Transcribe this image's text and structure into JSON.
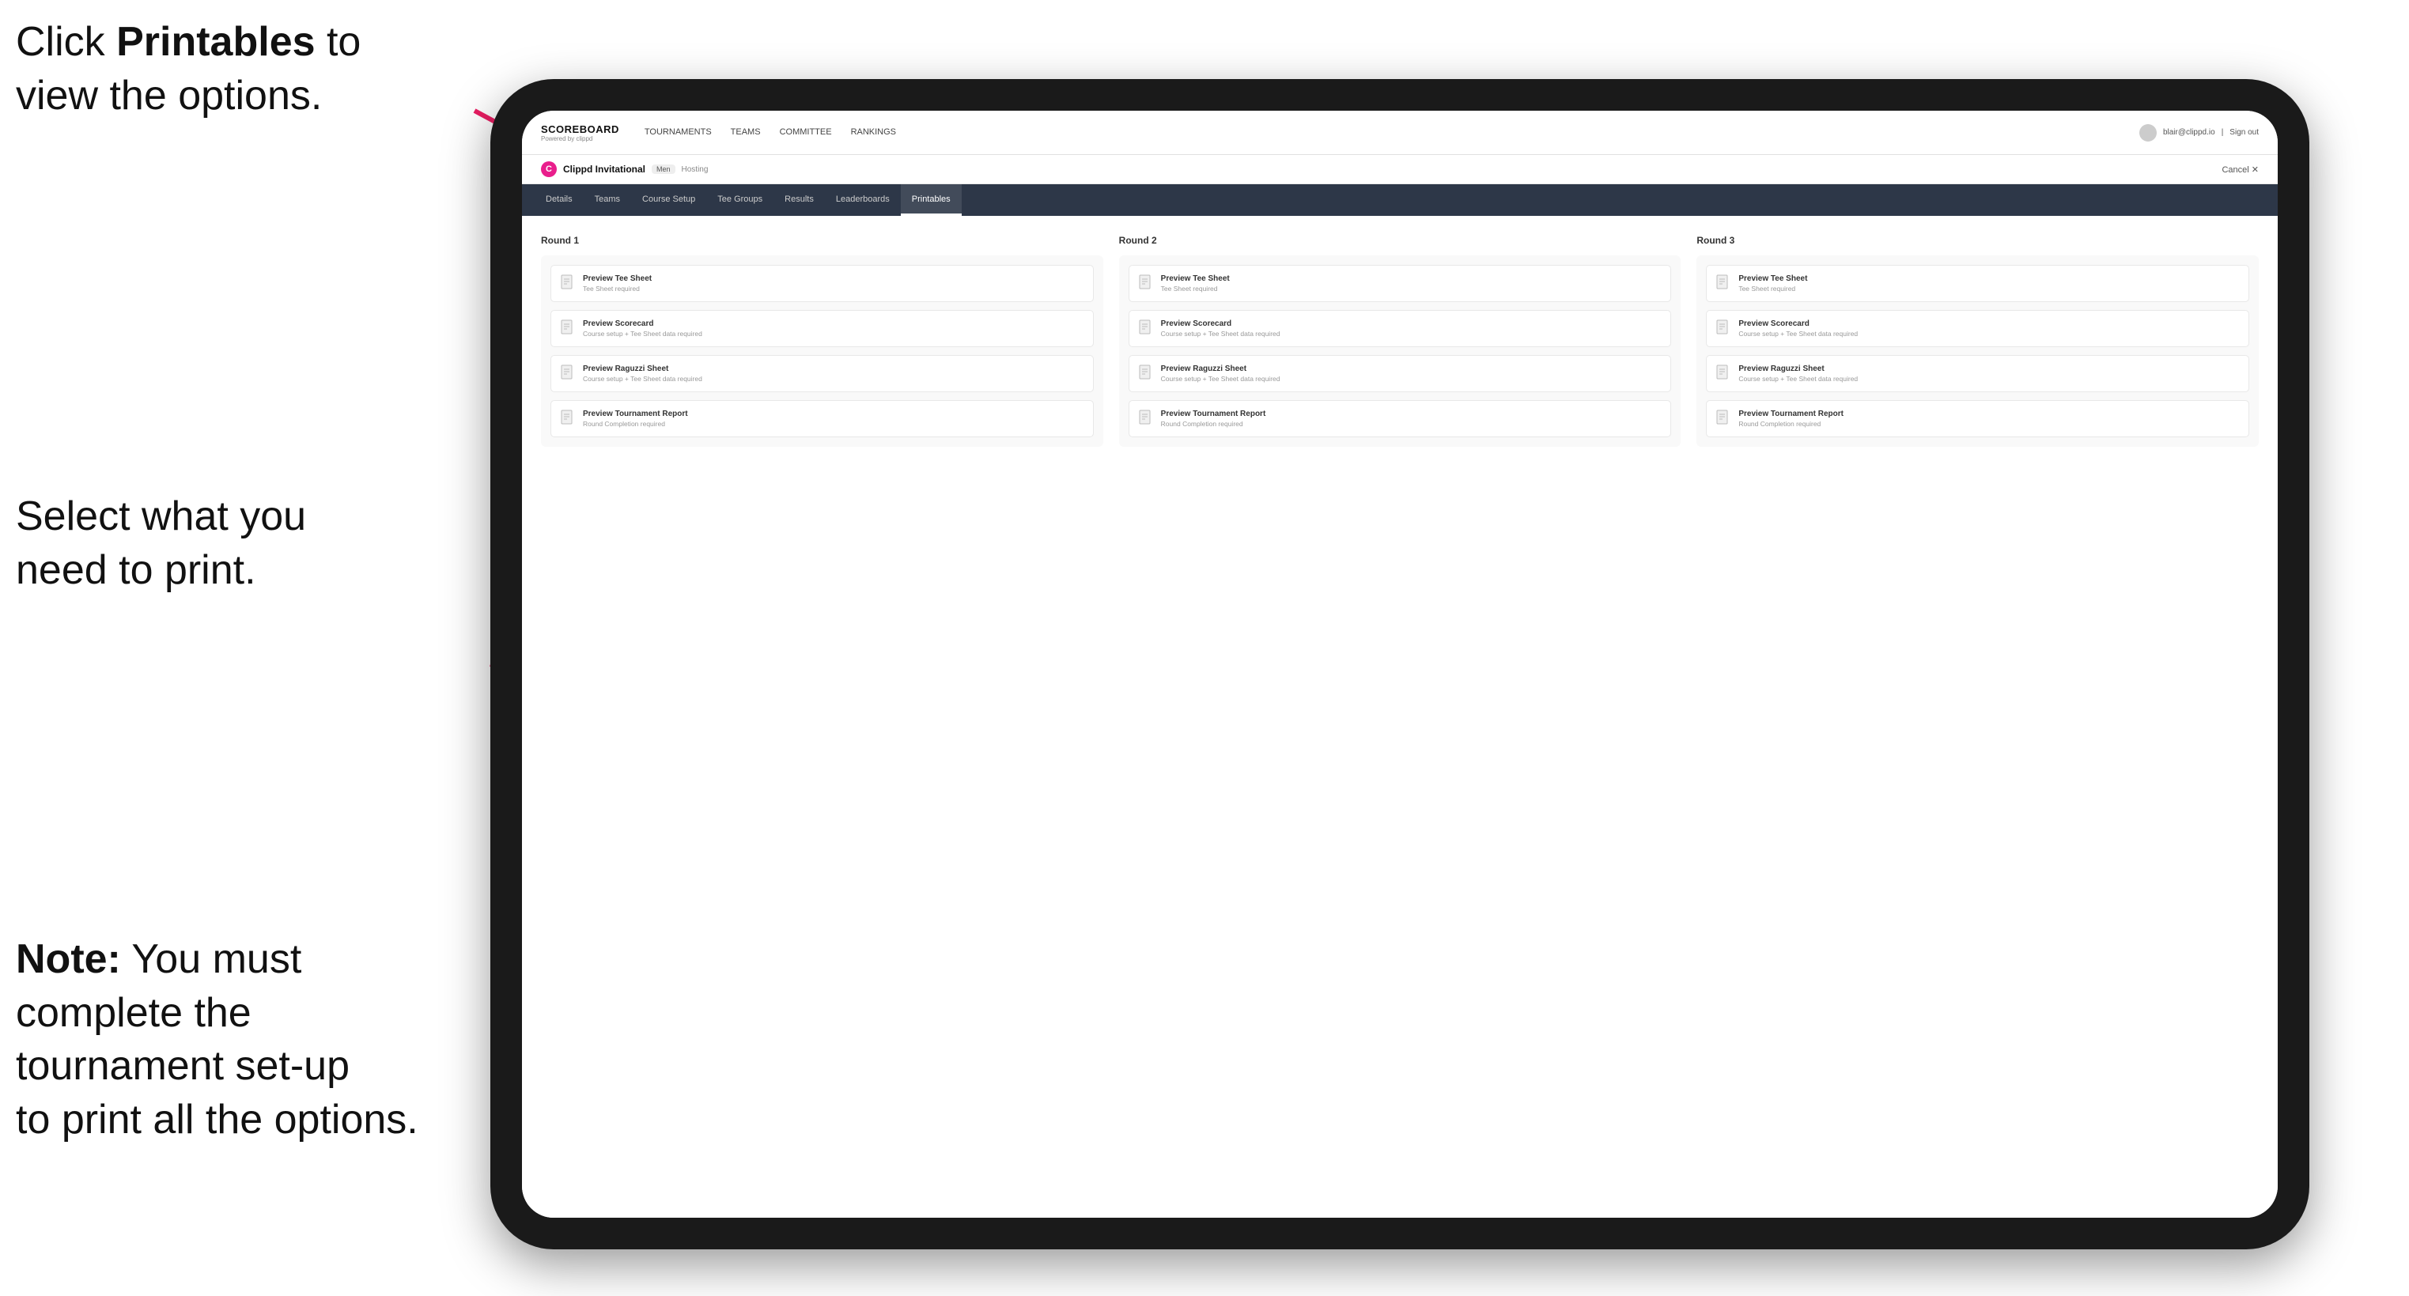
{
  "instructions": {
    "top": {
      "prefix": "Click ",
      "bold": "Printables",
      "suffix": " to\nview the options."
    },
    "mid": "Select what you\nneed to print.",
    "bottom": {
      "bold_prefix": "Note:",
      "text": " You must\ncomplete the\ntournament set-up\nto print all the options."
    }
  },
  "top_nav": {
    "logo_title": "SCOREBOARD",
    "logo_sub": "Powered by clippd",
    "links": [
      {
        "label": "TOURNAMENTS",
        "active": false
      },
      {
        "label": "TEAMS",
        "active": false
      },
      {
        "label": "COMMITTEE",
        "active": false
      },
      {
        "label": "RANKINGS",
        "active": false
      }
    ],
    "user_email": "blair@clippd.io",
    "sign_out": "Sign out"
  },
  "sub_header": {
    "icon_letter": "C",
    "tournament_name": "Clippd Invitational",
    "tournament_category": "Men",
    "tournament_status": "Hosting",
    "cancel_label": "Cancel ✕"
  },
  "tabs": [
    {
      "label": "Details",
      "active": false
    },
    {
      "label": "Teams",
      "active": false
    },
    {
      "label": "Course Setup",
      "active": false
    },
    {
      "label": "Tee Groups",
      "active": false
    },
    {
      "label": "Results",
      "active": false
    },
    {
      "label": "Leaderboards",
      "active": false
    },
    {
      "label": "Printables",
      "active": true
    }
  ],
  "rounds": [
    {
      "title": "Round 1",
      "cards": [
        {
          "title": "Preview Tee Sheet",
          "subtitle": "Tee Sheet required"
        },
        {
          "title": "Preview Scorecard",
          "subtitle": "Course setup + Tee Sheet data required"
        },
        {
          "title": "Preview Raguzzi Sheet",
          "subtitle": "Course setup + Tee Sheet data required"
        },
        {
          "title": "Preview Tournament Report",
          "subtitle": "Round Completion required"
        }
      ]
    },
    {
      "title": "Round 2",
      "cards": [
        {
          "title": "Preview Tee Sheet",
          "subtitle": "Tee Sheet required"
        },
        {
          "title": "Preview Scorecard",
          "subtitle": "Course setup + Tee Sheet data required"
        },
        {
          "title": "Preview Raguzzi Sheet",
          "subtitle": "Course setup + Tee Sheet data required"
        },
        {
          "title": "Preview Tournament Report",
          "subtitle": "Round Completion required"
        }
      ]
    },
    {
      "title": "Round 3",
      "cards": [
        {
          "title": "Preview Tee Sheet",
          "subtitle": "Tee Sheet required"
        },
        {
          "title": "Preview Scorecard",
          "subtitle": "Course setup + Tee Sheet data required"
        },
        {
          "title": "Preview Raguzzi Sheet",
          "subtitle": "Course setup + Tee Sheet data required"
        },
        {
          "title": "Preview Tournament Report",
          "subtitle": "Round Completion required"
        }
      ]
    }
  ]
}
